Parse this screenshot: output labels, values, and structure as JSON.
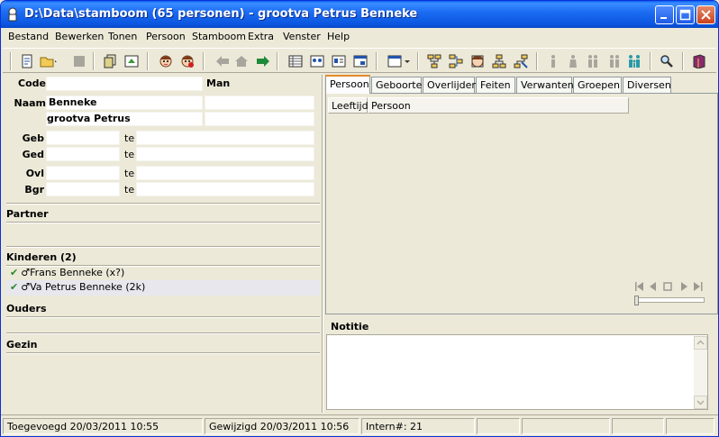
{
  "window": {
    "title": "D:\\Data\\stamboom (65 personen) - grootva Petrus Benneke"
  },
  "menu": [
    "Bestand",
    "Bewerken",
    "Tonen",
    "Persoon",
    "Stamboom",
    "Extra",
    "Venster",
    "Help"
  ],
  "person": {
    "code_label": "Code",
    "code_value": "",
    "sex": "Man",
    "naam_label": "Naam",
    "surname": "Benneke",
    "givenname": "grootva Petrus",
    "rows": [
      {
        "label": "Geb",
        "date": "",
        "te": "te",
        "place": ""
      },
      {
        "label": "Ged",
        "date": "",
        "te": "te",
        "place": ""
      },
      {
        "label": "Ovl",
        "date": "",
        "te": "te",
        "place": ""
      },
      {
        "label": "Bgr",
        "date": "",
        "te": "te",
        "place": ""
      }
    ]
  },
  "sections": {
    "partner": "Partner",
    "kinderen": "Kinderen (2)",
    "ouders": "Ouders",
    "gezin": "Gezin"
  },
  "children": [
    {
      "check": "✔",
      "symbol": "♂",
      "name": "Frans Benneke (x?)"
    },
    {
      "check": "✔",
      "symbol": "♂",
      "name": "Va Petrus Benneke (2k)"
    }
  ],
  "tabs": [
    "Persoon",
    "Geboorte",
    "Overlijden",
    "Feiten",
    "Verwanten",
    "Groepen",
    "Diversen"
  ],
  "grid": {
    "columns": [
      "Leeftijd",
      "Persoon"
    ]
  },
  "notes": {
    "label": "Notitie"
  },
  "status": {
    "added": "Toegevoegd 20/03/2011 10:55",
    "modified": "Gewijzigd 20/03/2011 10:56",
    "intern": "Intern#: 21"
  },
  "colors": {
    "titlebar": "#0A5EEF",
    "face": "#ECE9D8",
    "tab_accent": "#E68B2C"
  }
}
